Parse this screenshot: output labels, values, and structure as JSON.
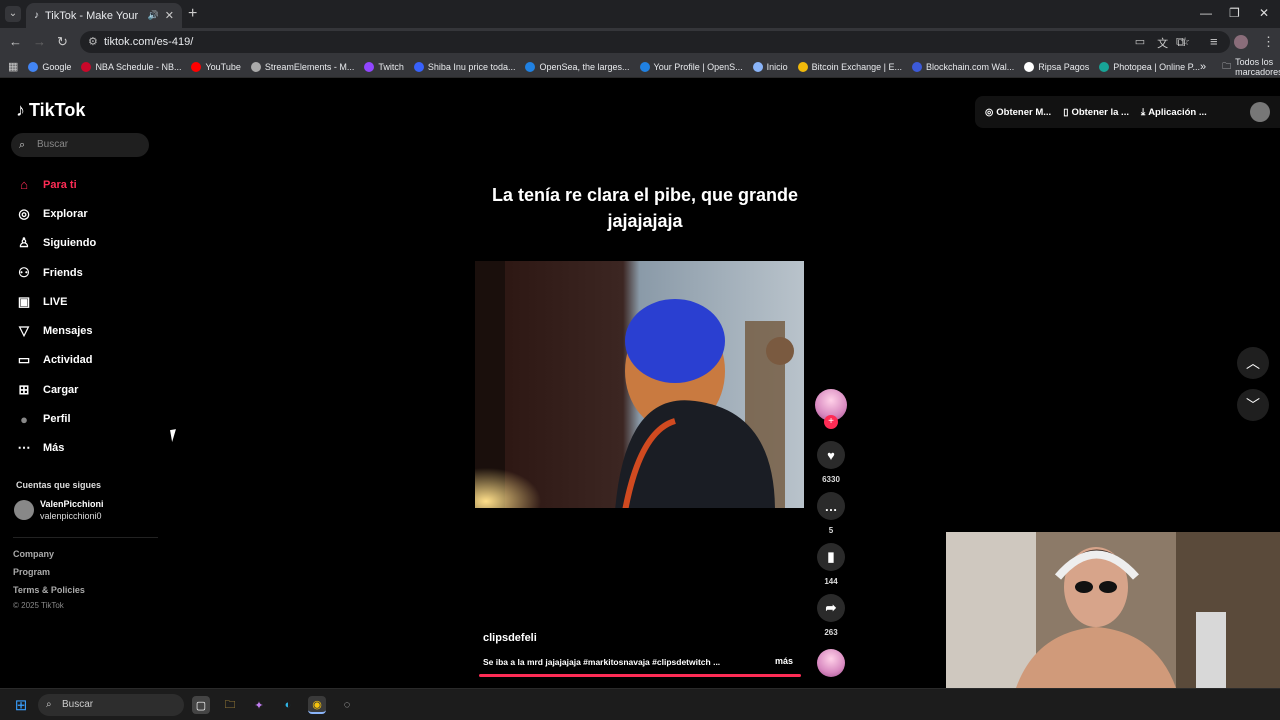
{
  "browser": {
    "tab_title": "TikTok - Make Your Day",
    "url": "tiktok.com/es-419/",
    "bookmarks": [
      {
        "label": "Google",
        "color": "#4285f4"
      },
      {
        "label": "NBA Schedule - NB...",
        "color": "#c9082a"
      },
      {
        "label": "YouTube",
        "color": "#ff0000"
      },
      {
        "label": "StreamElements - M...",
        "color": "#aaaaaa"
      },
      {
        "label": "Twitch",
        "color": "#9146ff"
      },
      {
        "label": "Shiba Inu price toda...",
        "color": "#3861fb"
      },
      {
        "label": "OpenSea, the larges...",
        "color": "#2081e2"
      },
      {
        "label": "Your Profile | OpenS...",
        "color": "#2081e2"
      },
      {
        "label": "Inicio",
        "color": "#8ab4f8"
      },
      {
        "label": "Bitcoin Exchange | E...",
        "color": "#f0b90b"
      },
      {
        "label": "Blockchain.com Wal...",
        "color": "#3c5ad9"
      },
      {
        "label": "Ripsa Pagos",
        "color": "#ffffff"
      },
      {
        "label": "Photopea | Online P...",
        "color": "#18a497"
      }
    ],
    "bookmarks_more": "»",
    "all_bookmarks": "Todos los marcadores"
  },
  "tiktok": {
    "logo": "TikTok",
    "search_placeholder": "Buscar",
    "nav": [
      {
        "label": "Para ti",
        "icon": "home-icon",
        "active": true
      },
      {
        "label": "Explorar",
        "icon": "compass-icon"
      },
      {
        "label": "Siguiendo",
        "icon": "following-icon"
      },
      {
        "label": "Friends",
        "icon": "friends-icon"
      },
      {
        "label": "LIVE",
        "icon": "live-icon"
      },
      {
        "label": "Mensajes",
        "icon": "messages-icon"
      },
      {
        "label": "Actividad",
        "icon": "activity-icon"
      },
      {
        "label": "Cargar",
        "icon": "upload-icon"
      },
      {
        "label": "Perfil",
        "icon": "profile-icon"
      },
      {
        "label": "Más",
        "icon": "more-icon"
      }
    ],
    "following_header": "Cuentas que sigues",
    "following_account": {
      "name": "ValenPicchioni",
      "username": "valenpicchioni0"
    },
    "footer": [
      "Company",
      "Program",
      "Terms & Policies"
    ],
    "copyright": "© 2025 TikTok",
    "top_actions": [
      "Obtener M...",
      "Obtener la ...",
      "Aplicación ..."
    ],
    "video": {
      "caption_title": "La tenía re clara el pibe, que grande jajajajaja",
      "author": "clipsdefeli",
      "description": "Se iba a la mrd jajajajaja #markitosnavaja #clipsdetwitch ...",
      "more": "más",
      "likes": "6330",
      "comments": "5",
      "saves": "144",
      "shares": "263",
      "progress_fraction": 1.0
    }
  },
  "taskbar": {
    "search_placeholder": "Buscar"
  }
}
